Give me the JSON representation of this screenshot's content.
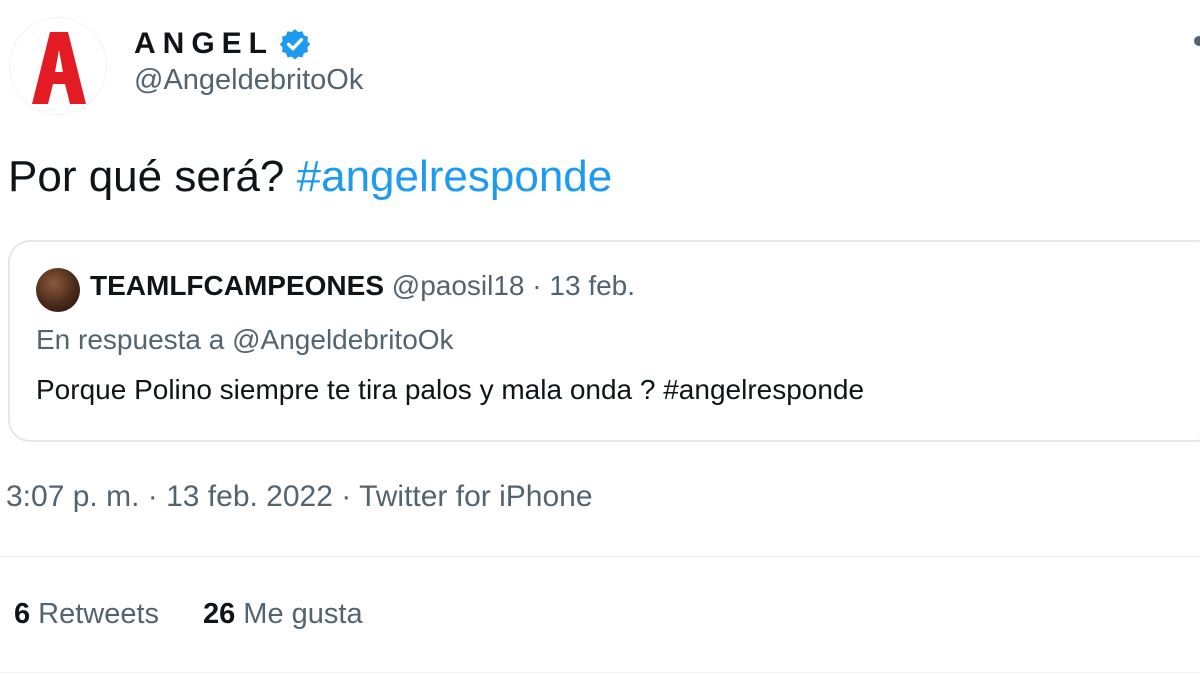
{
  "author": {
    "display_name": "ANGEL",
    "handle": "@AngeldebritoOk",
    "avatar_letter": "A",
    "avatar_color": "#e31b23",
    "verified_color": "#1d9bf0"
  },
  "tweet": {
    "text": "Por qué será?",
    "hashtag": "#angelresponde"
  },
  "quoted": {
    "name": "TEAMLFCAMPEONES",
    "handle": "@paosil18",
    "separator": "·",
    "date": "13 feb.",
    "reply_prefix": "En respuesta a",
    "reply_to": "@AngeldebritoOk",
    "text": "Porque Polino siempre te tira palos y mala onda ? #angelresponde"
  },
  "meta": {
    "time": "3:07 p. m.",
    "separator": "·",
    "date": "13 feb. 2022",
    "source": "Twitter for iPhone"
  },
  "stats": {
    "retweets_count": "6",
    "retweets_label": "Retweets",
    "likes_count": "26",
    "likes_label": "Me gusta"
  }
}
